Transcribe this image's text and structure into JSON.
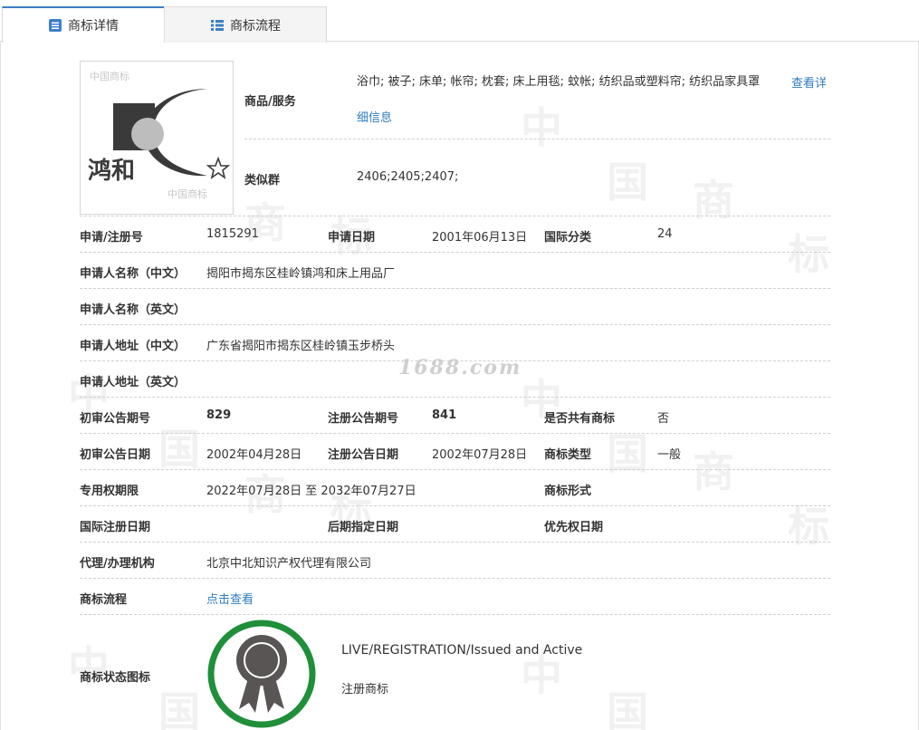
{
  "tabs": [
    {
      "label": "商标详情",
      "active": true
    },
    {
      "label": "商标流程",
      "active": false
    }
  ],
  "watermark_char_a": "中",
  "watermark_char_b": "国",
  "watermark_char_c": "商",
  "watermark_char_d": "标",
  "logo": {
    "text": "鸿和"
  },
  "goods": {
    "label": "商品/服务",
    "text": "浴巾; 被子; 床单; 帐帘; 枕套; 床上用毯; 蚊帐; 纺织品或塑料帘; 纺织品家具罩",
    "link_part1": "查看详",
    "link_part2": "细信息"
  },
  "similar": {
    "label": "类似群",
    "value": "2406;2405;2407;"
  },
  "rows": {
    "reg_no_label": "申请/注册号",
    "reg_no": "1815291",
    "apply_date_label": "申请日期",
    "apply_date": "2001年06月13日",
    "intl_class_label": "国际分类",
    "intl_class": "24",
    "applicant_cn_label": "申请人名称（中文）",
    "applicant_cn": "揭阳市揭东区桂岭镇鸿和床上用品厂",
    "applicant_en_label": "申请人名称（英文）",
    "applicant_en": "",
    "address_cn_label": "申请人地址（中文）",
    "address_cn": "广东省揭阳市揭东区桂岭镇玉步桥头",
    "address_en_label": "申请人地址（英文）",
    "address_en": "",
    "prelim_no_label": "初审公告期号",
    "prelim_no": "829",
    "reg_pub_no_label": "注册公告期号",
    "reg_pub_no": "841",
    "shared_label": "是否共有商标",
    "shared": "否",
    "prelim_date_label": "初审公告日期",
    "prelim_date": "2002年04月28日",
    "reg_pub_date_label": "注册公告日期",
    "reg_pub_date": "2002年07月28日",
    "tm_type_label": "商标类型",
    "tm_type": "一般",
    "exclusive_label": "专用权期限",
    "exclusive": "2022年07月28日 至 2032年07月27日",
    "tm_form_label": "商标形式",
    "tm_form": "",
    "intl_reg_date_label": "国际注册日期",
    "intl_reg_date": "",
    "later_date_label": "后期指定日期",
    "later_date": "",
    "priority_date_label": "优先权日期",
    "priority_date": "",
    "agent_label": "代理/办理机构",
    "agent": "北京中北知识产权代理有限公司",
    "flow_label": "商标流程",
    "flow_link": "点击查看",
    "status_icon_label": "商标状态图标"
  },
  "site_watermark": "1688.com",
  "status": {
    "line1": "LIVE/REGISTRATION/Issued and Active",
    "line2": "注册商标",
    "ring_color": "#1f8f3a",
    "badge_color": "#5a5555"
  },
  "colors": {
    "link": "#2f7cbf",
    "tab_accent": "#3c7fc8"
  }
}
